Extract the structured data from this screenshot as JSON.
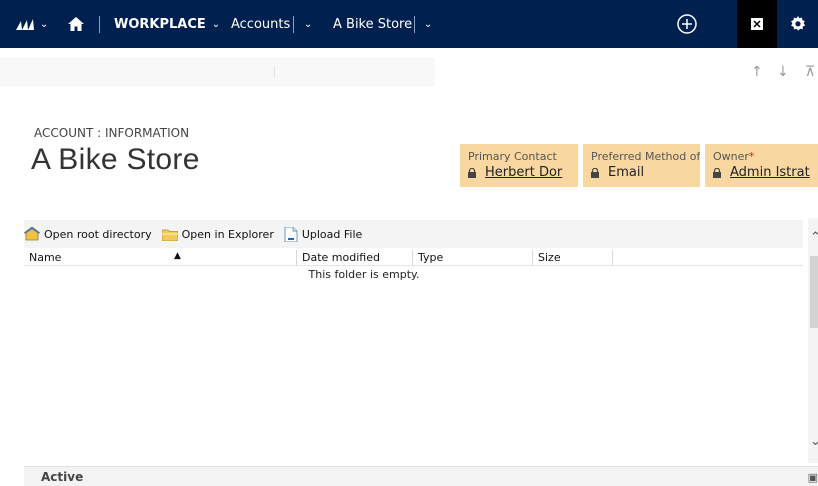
{
  "nav": {
    "workplace_label": "WORKPLACE",
    "accounts_label": "Accounts",
    "record_label": "A Bike Store"
  },
  "header": {
    "entity_label": "ACCOUNT : INFORMATION",
    "record_title": "A Bike Store",
    "fields": [
      {
        "label": "Primary Contact",
        "value": "Herbert Dor",
        "link": true,
        "required": false
      },
      {
        "label": "Preferred Method of",
        "value": "Email",
        "link": false,
        "required": false
      },
      {
        "label": "Owner",
        "value": "Admin Istrat",
        "link": true,
        "required": true
      }
    ],
    "required_mark": "*"
  },
  "explorer": {
    "toolbar": [
      {
        "label": "Open root directory",
        "icon": "home-folder-icon"
      },
      {
        "label": "Open in Explorer",
        "icon": "folder-icon"
      },
      {
        "label": "Upload File",
        "icon": "upload-file-icon"
      }
    ],
    "columns": [
      "Name",
      "Date modified",
      "Type",
      "Size"
    ],
    "empty_message": "This folder is empty."
  },
  "status": {
    "state": "Active"
  },
  "colors": {
    "nav_bg": "#002050",
    "header_field_bg": "#f8d7a0"
  }
}
